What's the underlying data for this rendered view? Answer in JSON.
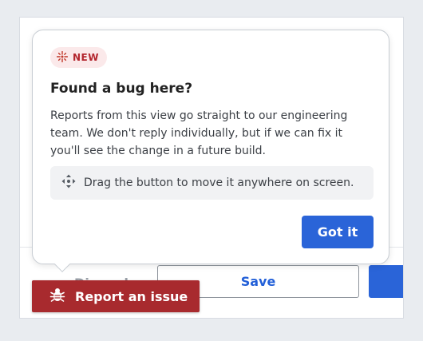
{
  "footer": {
    "discard_label": "Discard",
    "save_label": "Save"
  },
  "popover": {
    "badge": "NEW",
    "title": "Found a bug here?",
    "body": "Reports from this view go straight to our engineering team. We don't reply individually, but if we can fix it you'll see the change in a future build.",
    "hint": "Drag the button to move it anywhere on screen.",
    "confirm_label": "Got it"
  },
  "report_button": {
    "label": "Report an issue"
  },
  "icons": {
    "badge": "sparkle-icon",
    "hint": "move-arrows-icon",
    "report": "bug-icon"
  },
  "colors": {
    "accent": "#2a64d8",
    "danger": "#a82a2e",
    "badge_bg": "#fbe9ea",
    "badge_text": "#b3262e"
  }
}
